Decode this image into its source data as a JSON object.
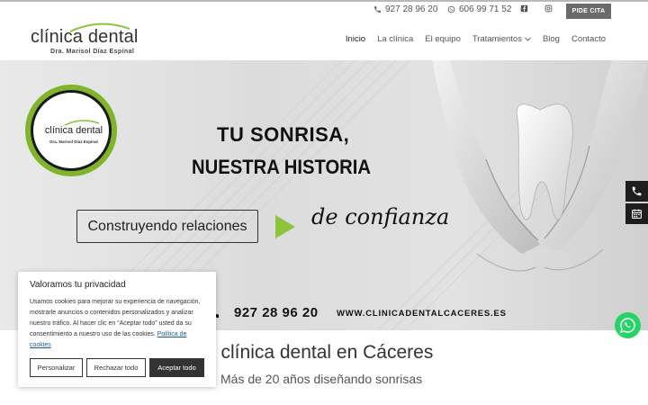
{
  "topbar": {
    "phone1": "927 28 96 20",
    "phone2": "606 99 71 52",
    "cta": "PIDE CITA"
  },
  "header": {
    "logo_text": "clínica dental",
    "logo_sub": "Dra. Marisol Díaz Espinal"
  },
  "nav": {
    "items": [
      "Inicio",
      "La clínica",
      "El equipo",
      "Tratamientos",
      "Blog",
      "Contacto"
    ]
  },
  "hero": {
    "badge_text": "clínica dental",
    "badge_sub": "Dra. Marisol Díaz Espinal",
    "title1": "TU SONRISA,",
    "title2": "NUESTRA HISTORIA",
    "box": "Construyendo relaciones",
    "script": "de confianza",
    "phone": "927 28 96 20",
    "web": "WWW.CLINICADENTALCACERES.ES"
  },
  "section": {
    "title": "u clínica dental en Cáceres",
    "subtitle": "Más de 20 años diseñando sonrisas"
  },
  "cookie": {
    "title": "Valoramos tu privacidad",
    "text": "Usamos cookies para mejorar su experiencia de navegación, mostrarle anuncios o contenidos personalizados y analizar nuestro tráfico. Al hacer clic en “Aceptar todo” usted da su consentimiento a nuestro uso de las cookies.",
    "link": "Política de cookies",
    "btn_customize": "Personalizar",
    "btn_reject": "Rechazar todo",
    "btn_accept": "Aceptar todo"
  },
  "colors": {
    "accent_green": "#7fb42b",
    "dark": "#1e1e1e",
    "whatsapp": "#25d366"
  }
}
